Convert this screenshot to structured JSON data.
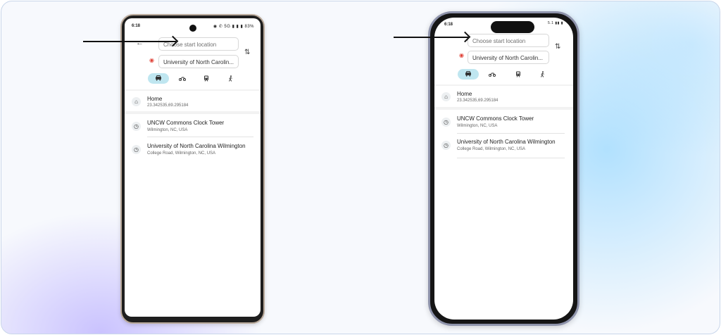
{
  "android": {
    "status": {
      "time": "6:18",
      "icons": "◉ ✆ 5G ▮ ▮ ▮ 83%"
    },
    "start_placeholder": "Choose start location",
    "destination": "University of North Carolin...",
    "modes": [
      {
        "name": "car",
        "active": true
      },
      {
        "name": "motorcycle",
        "active": false
      },
      {
        "name": "transit",
        "active": false
      },
      {
        "name": "walk",
        "active": false
      }
    ],
    "list": [
      {
        "icon": "home-icon",
        "title": "Home",
        "subtitle": "23.342535,69.295184"
      },
      {
        "icon": "clock-icon",
        "title": "UNCW Commons Clock Tower",
        "subtitle": "Wilmington, NC, USA"
      },
      {
        "icon": "clock-icon",
        "title": "University of North Carolina Wilmington",
        "subtitle": "College Road, Wilmington, NC, USA"
      }
    ]
  },
  "iphone": {
    "status": {
      "time": "6:18",
      "icons": "5.1 ▮▮ ▮"
    },
    "start_placeholder": "Choose start location",
    "destination": "University of North Carolin...",
    "modes": [
      {
        "name": "car",
        "active": true
      },
      {
        "name": "motorcycle",
        "active": false
      },
      {
        "name": "transit",
        "active": false
      },
      {
        "name": "walk",
        "active": false
      }
    ],
    "list": [
      {
        "icon": "home-icon",
        "title": "Home",
        "subtitle": "23.342535,69.295184"
      },
      {
        "icon": "clock-icon",
        "title": "UNCW Commons Clock Tower",
        "subtitle": "Wilmington, NC, USA"
      },
      {
        "icon": "clock-icon",
        "title": "University of North Carolina Wilmington",
        "subtitle": "College Road, Wilmington, NC, USA"
      }
    ]
  },
  "colors": {
    "accent_mode": "#bfe6f0",
    "pin": "#e0443a"
  }
}
